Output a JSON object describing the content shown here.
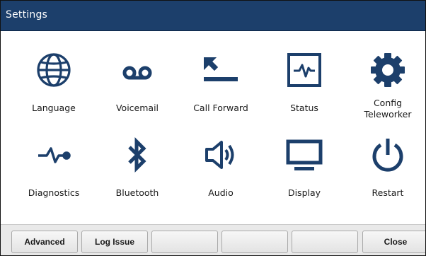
{
  "window": {
    "title": "Settings"
  },
  "colors": {
    "title_bar": "#1c3f6b",
    "icon": "#1c3f6b",
    "softkey_bar": "#e9e9e9"
  },
  "grid": {
    "items": [
      {
        "label": "Language",
        "icon": "globe-icon"
      },
      {
        "label": "Voicemail",
        "icon": "voicemail-icon"
      },
      {
        "label": "Call Forward",
        "icon": "call-forward-icon"
      },
      {
        "label": "Status",
        "icon": "status-monitor-icon"
      },
      {
        "label": "Config\nTeleworker",
        "icon": "gear-icon"
      },
      {
        "label": "Diagnostics",
        "icon": "pulse-icon"
      },
      {
        "label": "Bluetooth",
        "icon": "bluetooth-icon"
      },
      {
        "label": "Audio",
        "icon": "speaker-icon"
      },
      {
        "label": "Display",
        "icon": "monitor-icon"
      },
      {
        "label": "Restart",
        "icon": "power-icon"
      }
    ]
  },
  "softkeys": [
    {
      "label": "Advanced"
    },
    {
      "label": "Log Issue"
    },
    {
      "label": ""
    },
    {
      "label": ""
    },
    {
      "label": ""
    },
    {
      "label": "Close"
    }
  ]
}
